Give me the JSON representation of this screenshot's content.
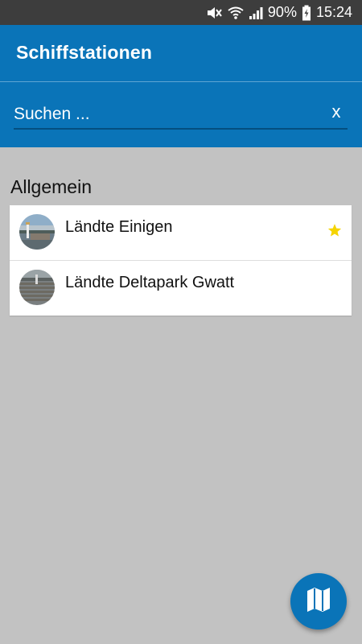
{
  "status_bar": {
    "battery": "90%",
    "time": "15:24",
    "icons": [
      "mute-icon",
      "wifi-icon",
      "signal-icon",
      "battery-charging-icon"
    ]
  },
  "app_bar": {
    "title": "Schiffstationen"
  },
  "search": {
    "placeholder": "Suchen ...",
    "value": "",
    "clear_label": "x"
  },
  "section": {
    "title": "Allgemein"
  },
  "stations": [
    {
      "name": "Ländte Einigen",
      "favorite": true,
      "avatar": "lake-harbor-photo"
    },
    {
      "name": "Ländte Deltapark Gwatt",
      "favorite": false,
      "avatar": "wooden-pier-photo"
    }
  ],
  "fab": {
    "icon": "map-icon"
  },
  "colors": {
    "primary": "#0a74b8",
    "status_bar": "#3d3d3d",
    "background": "#c2c2c2",
    "star": "#f5d400"
  }
}
